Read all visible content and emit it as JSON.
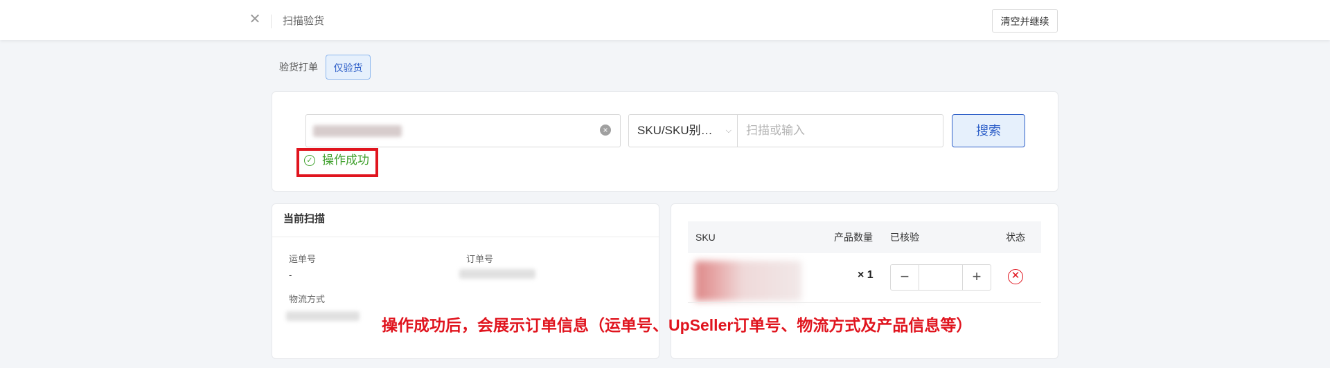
{
  "header": {
    "title": "扫描验货",
    "clear_button": "清空并继续"
  },
  "tabs": [
    {
      "label": "验货打单",
      "active": false
    },
    {
      "label": "仅验货",
      "active": true
    }
  ],
  "search": {
    "select_value": "SKU/SKU别…",
    "scan_placeholder": "扫描或输入",
    "search_button": "搜索",
    "success_message": "操作成功"
  },
  "current_scan": {
    "title": "当前扫描",
    "tracking_label": "运单号",
    "tracking_value": "-",
    "order_label": "订单号",
    "shipping_label": "物流方式"
  },
  "table": {
    "headers": {
      "sku": "SKU",
      "qty": "产品数量",
      "verified": "已核验",
      "status": "状态"
    },
    "rows": [
      {
        "quantity": "× 1",
        "verified_value": "",
        "status": "error"
      }
    ]
  },
  "annotation": "操作成功后，会展示订单信息（运单号、UpSeller订单号、物流方式及产品信息等）",
  "colors": {
    "primary": "#2e5fc8",
    "success": "#41a12f",
    "danger": "#e0141e",
    "background": "#f3f5f8"
  }
}
